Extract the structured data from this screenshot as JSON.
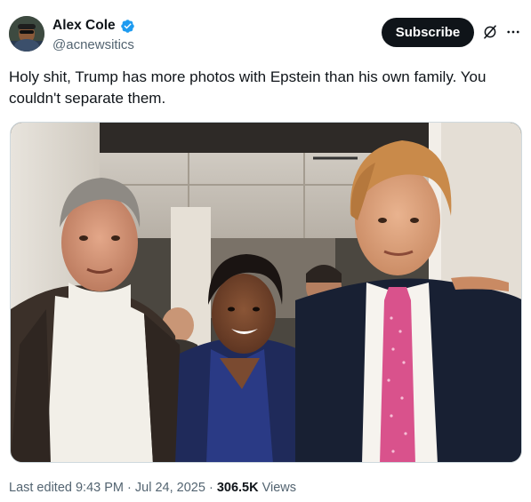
{
  "author": {
    "display_name": "Alex Cole",
    "handle": "@acnewsitics",
    "verified": true,
    "avatar_icon": "avatar-photo"
  },
  "actions": {
    "subscribe_label": "Subscribe",
    "grok_icon": "grok-icon",
    "more_icon": "more-icon"
  },
  "tweet": {
    "text": "Holy shit, Trump has more photos with Epstein than his own family. You couldn't separate them."
  },
  "meta": {
    "edited_prefix": "Last edited",
    "time": "9:43 PM",
    "separator": "·",
    "date": "Jul 24, 2025",
    "views_count": "306.5K",
    "views_label": "Views"
  },
  "colors": {
    "text_primary": "#0f1419",
    "text_secondary": "#536471",
    "verified_blue": "#1d9bf0",
    "subscribe_bg": "#0f1419",
    "border": "#cfd9de"
  }
}
